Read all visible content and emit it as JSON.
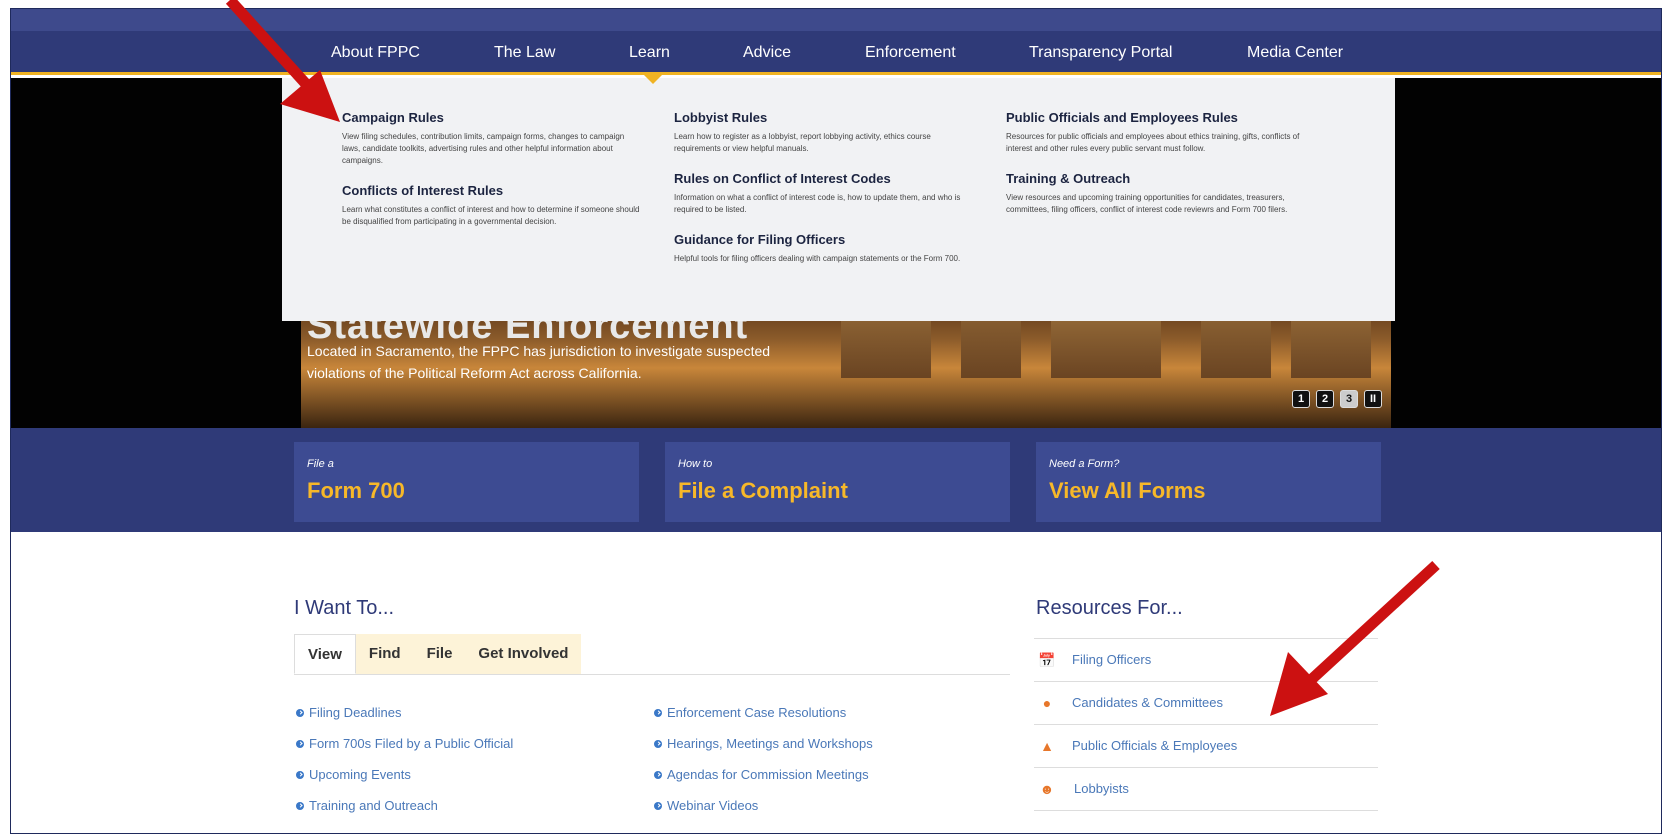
{
  "nav": {
    "items": [
      {
        "label": "About FPPC"
      },
      {
        "label": "The Law"
      },
      {
        "label": "Learn"
      },
      {
        "label": "Advice"
      },
      {
        "label": "Enforcement"
      },
      {
        "label": "Transparency Portal"
      },
      {
        "label": "Media Center"
      }
    ]
  },
  "mega_menu": {
    "col1": [
      {
        "title": "Campaign Rules",
        "desc": "View filing schedules, contribution limits, campaign forms, changes to campaign laws, candidate toolkits, advertising rules and other helpful information about campaigns."
      },
      {
        "title": "Conflicts of Interest Rules",
        "desc": "Learn what constitutes a conflict of interest and how to determine if someone should be disqualified from participating in a governmental decision."
      }
    ],
    "col2": [
      {
        "title": "Lobbyist Rules",
        "desc": "Learn how to register as a lobbyist, report lobbying activity, ethics course requirements or view helpful manuals."
      },
      {
        "title": "Rules on Conflict of Interest Codes",
        "desc": "Information on what a conflict of interest code is, how to update them, and who is required to be listed."
      },
      {
        "title": "Guidance for Filing Officers",
        "desc": "Helpful tools for filing officers dealing with campaign statements or the Form 700."
      }
    ],
    "col3": [
      {
        "title": "Public Officials and Employees Rules",
        "desc": "Resources for public officials and employees about ethics training, gifts, conflicts of interest and other rules every public servant must follow."
      },
      {
        "title": "Training & Outreach",
        "desc": "View resources and upcoming training opportunities for candidates, treasurers, committees, filing officers, conflict of interest code reviewrs and Form 700 filers."
      }
    ]
  },
  "hero": {
    "title": "Statewide Enforcement",
    "text": "Located in Sacramento, the FPPC has jurisdiction to investigate suspected violations of the Political Reform Act across California.",
    "slides": [
      "1",
      "2",
      "3"
    ],
    "active_slide": "3",
    "pause_label": "II"
  },
  "quick_links": [
    {
      "small": "File a",
      "big": "Form 700"
    },
    {
      "small": "How to",
      "big": "File a Complaint"
    },
    {
      "small": "Need a Form?",
      "big": "View All Forms"
    }
  ],
  "want_to": {
    "title": "I Want To...",
    "tabs": [
      "View",
      "Find",
      "File",
      "Get Involved"
    ],
    "active_tab": "View",
    "links_left": [
      "Filing Deadlines",
      "Form 700s Filed by a Public Official",
      "Upcoming Events",
      "Training and Outreach"
    ],
    "links_right": [
      "Enforcement Case Resolutions",
      "Hearings, Meetings and Workshops",
      "Agendas for Commission Meetings",
      "Webinar Videos"
    ]
  },
  "resources": {
    "title": "Resources For...",
    "items": [
      {
        "label": "Filing Officers",
        "icon": "calendar-icon"
      },
      {
        "label": "Candidates & Committees",
        "icon": "speech-bubble-icon"
      },
      {
        "label": "Public Officials & Employees",
        "icon": "capitol-icon"
      },
      {
        "label": "Lobbyists",
        "icon": "people-icon"
      }
    ]
  },
  "colors": {
    "navy": "#2f3a78",
    "gold": "#f7b829",
    "link": "#4a78b8",
    "arrow": "#cc1111"
  }
}
